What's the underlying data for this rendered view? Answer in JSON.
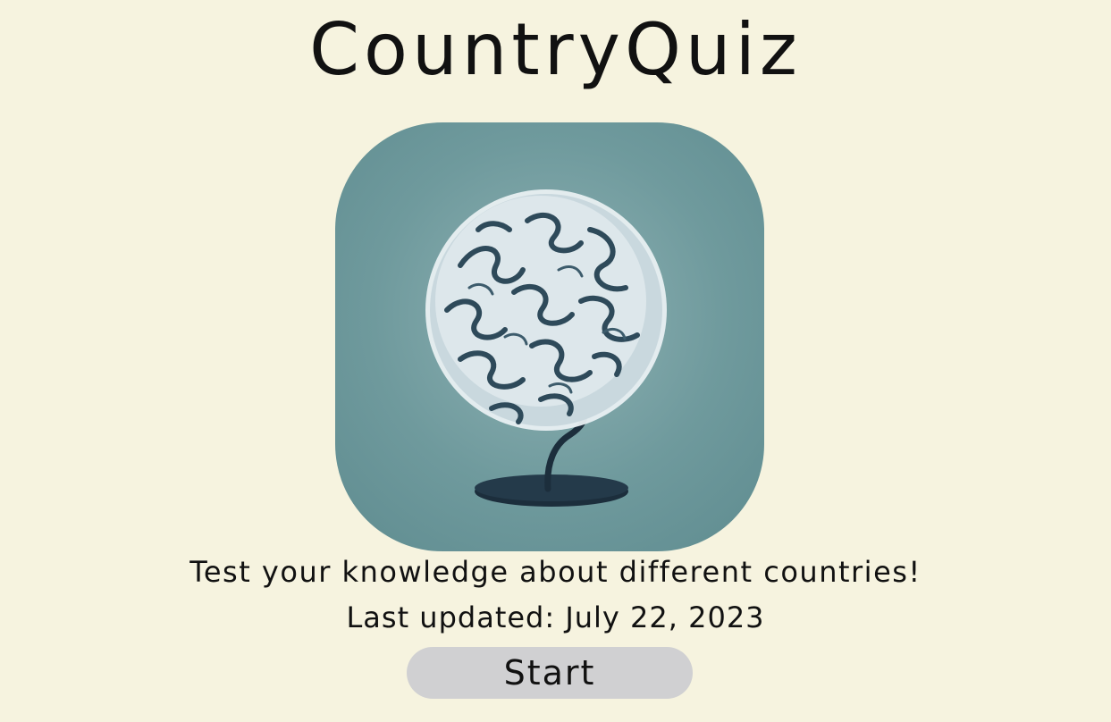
{
  "header": {
    "title": "CountryQuiz"
  },
  "hero": {
    "image_icon": "brain-globe-icon",
    "colors": {
      "tile_background": "#6f9a9d",
      "brain": "#dfe8ec",
      "brain_fold": "#2e4a5a",
      "stand": "#1c2e3c"
    }
  },
  "intro": {
    "tagline": "Test your knowledge about different countries!",
    "last_updated": "Last updated: July 22, 2023"
  },
  "actions": {
    "start_label": "Start"
  },
  "theme": {
    "page_background": "#f6f3df",
    "button_background": "#d0d0d2",
    "text_color": "#111111"
  }
}
